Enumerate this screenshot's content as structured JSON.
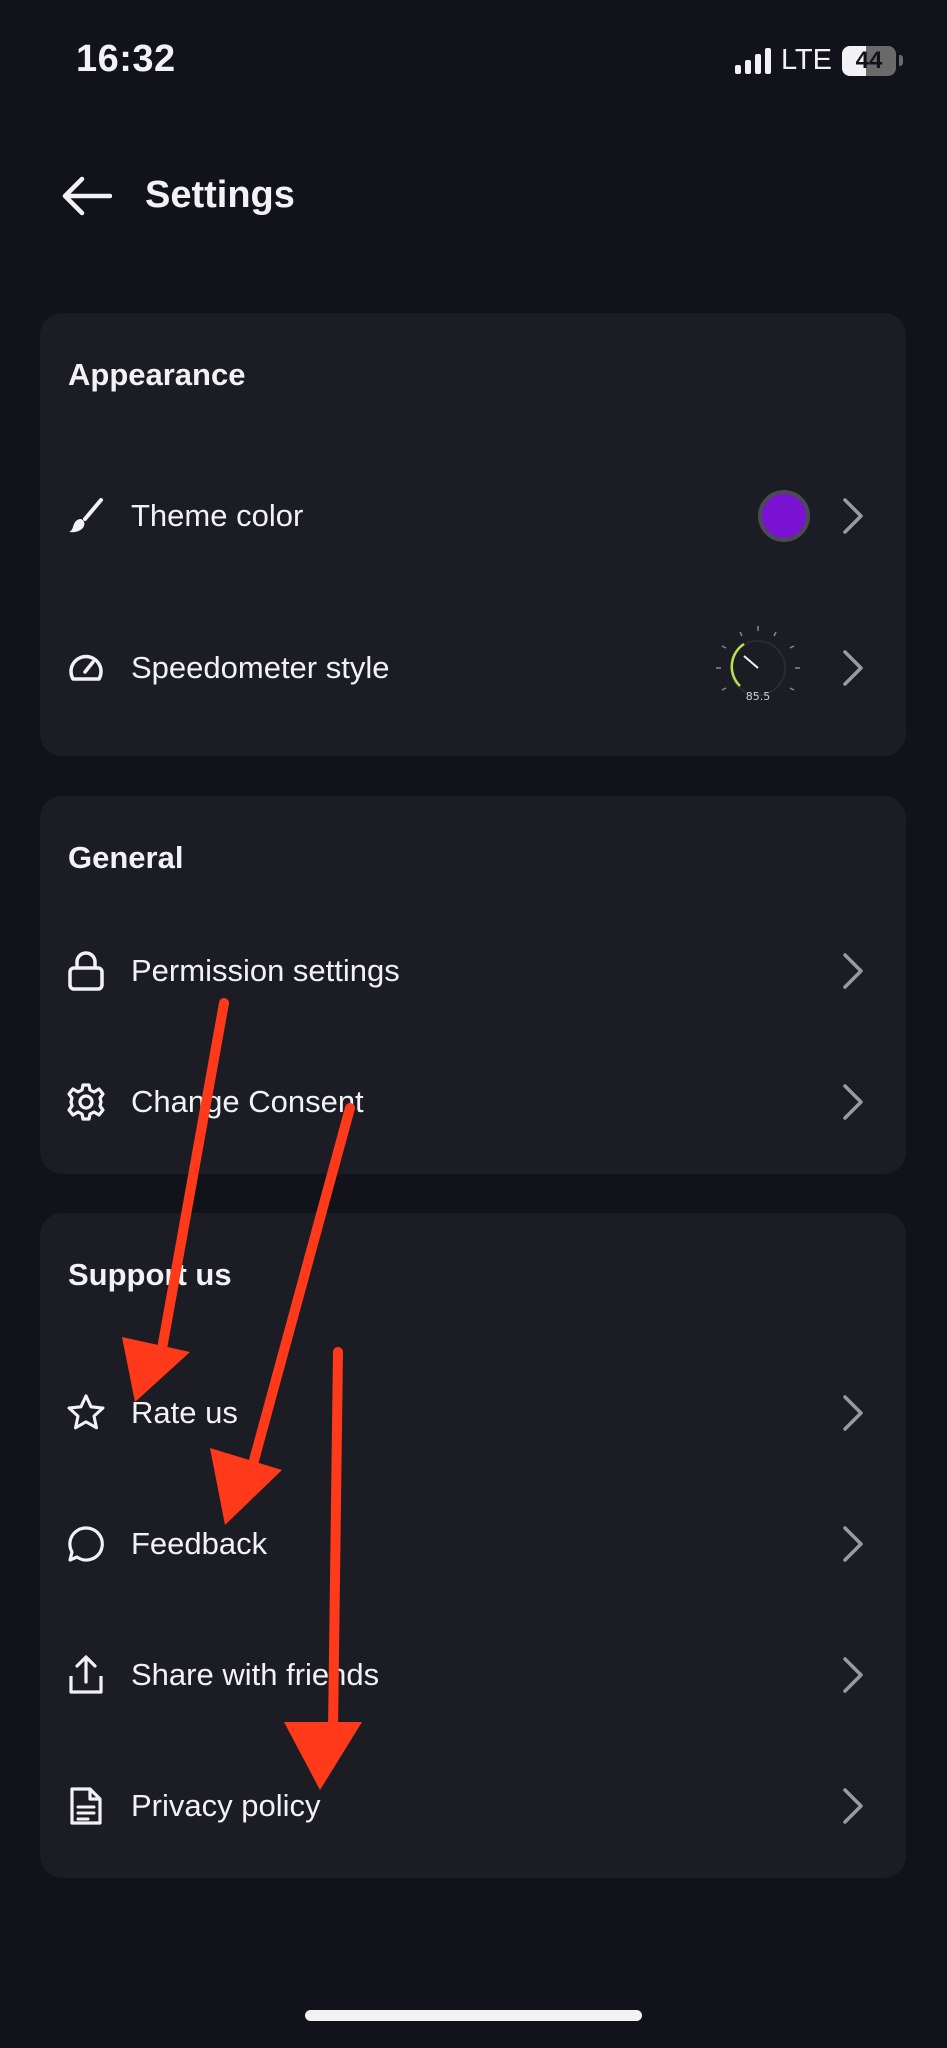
{
  "status_bar": {
    "time": "16:32",
    "network": "LTE",
    "battery": "44",
    "battery_level_percent": 44
  },
  "header": {
    "title": "Settings",
    "back_icon": "arrow-left-icon"
  },
  "sections": [
    {
      "title": "Appearance",
      "items": [
        {
          "label": "Theme color",
          "icon": "paintbrush-icon",
          "accessory": "color-swatch",
          "swatch_color": "#7a12d4"
        },
        {
          "label": "Speedometer style",
          "icon": "gauge-icon",
          "accessory": "speedometer-preview",
          "preview_value": "85.5"
        }
      ]
    },
    {
      "title": "General",
      "items": [
        {
          "label": "Permission settings",
          "icon": "lock-icon"
        },
        {
          "label": "Change Consent",
          "icon": "gear-icon"
        }
      ]
    },
    {
      "title": "Support us",
      "items": [
        {
          "label": "Rate us",
          "icon": "star-icon"
        },
        {
          "label": "Feedback",
          "icon": "chat-bubble-icon"
        },
        {
          "label": "Share with friends",
          "icon": "share-icon"
        },
        {
          "label": "Privacy policy",
          "icon": "document-icon"
        }
      ]
    }
  ],
  "annotations": {
    "arrow_color": "#ff3a1a"
  },
  "colors": {
    "background": "#12121a",
    "card": "#1c1c25",
    "text": "#f2f2f5",
    "accent_green": "#b5e34a"
  }
}
